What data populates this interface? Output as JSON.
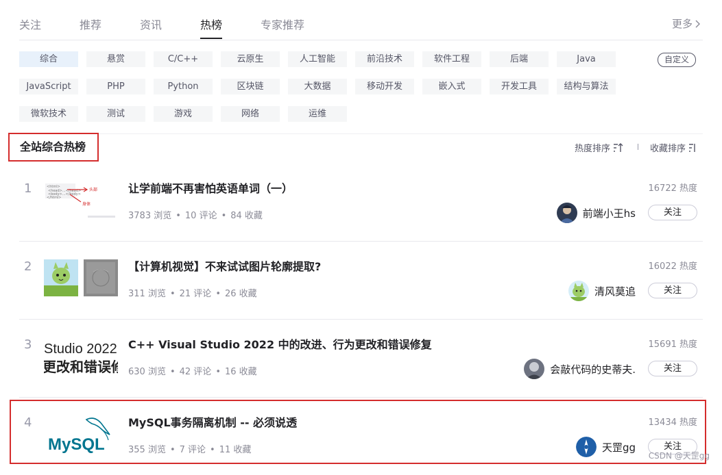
{
  "tabs": [
    {
      "label": "关注"
    },
    {
      "label": "推荐"
    },
    {
      "label": "资讯"
    },
    {
      "label": "热榜",
      "active": true
    },
    {
      "label": "专家推荐"
    }
  ],
  "more_label": "更多",
  "categories": [
    "综合",
    "悬赏",
    "C/C++",
    "云原生",
    "人工智能",
    "前沿技术",
    "软件工程",
    "后端",
    "Java",
    "JavaScript",
    "PHP",
    "Python",
    "区块链",
    "大数据",
    "移动开发",
    "嵌入式",
    "开发工具",
    "结构与算法",
    "微软技术",
    "测试",
    "游戏",
    "网络",
    "运维"
  ],
  "active_category": "综合",
  "custom_label": "自定义",
  "section": {
    "title": "全站综合热榜",
    "sort_heat": "热度排序",
    "sort_fav": "收藏排序"
  },
  "articles": [
    {
      "rank": "1",
      "title": "让学前端不再害怕英语单词（一）",
      "views": "3783 浏览",
      "comments": "10 评论",
      "favorites": "84 收藏",
      "heat": "16722 热度",
      "author": "前端小王hs",
      "follow": "关注"
    },
    {
      "rank": "2",
      "title": "【计算机视觉】不来试试图片轮廓提取?",
      "views": "311 浏览",
      "comments": "21 评论",
      "favorites": "26 收藏",
      "heat": "16022 热度",
      "author": "清风莫追",
      "follow": "关注"
    },
    {
      "rank": "3",
      "title": "C++ Visual Studio 2022 中的改进、行为更改和错误修复",
      "views": "630 浏览",
      "comments": "42 评论",
      "favorites": "16 收藏",
      "heat": "15691 热度",
      "author": "会敲代码的史蒂夫.",
      "follow": "关注",
      "thumb_text": [
        "Studio 2022",
        "更改和错误修"
      ]
    },
    {
      "rank": "4",
      "title": "MySQL事务隔离机制 -- 必须说透",
      "views": "355 浏览",
      "comments": "7 评论",
      "favorites": "11 收藏",
      "heat": "13434 热度",
      "author": "天罡gg",
      "follow": "关注",
      "thumb_text": [
        "MySQL"
      ]
    }
  ],
  "thumb1_text": {
    "l1": "<html>",
    "l2": "<head>...</head>",
    "l3": "<body>...</body>",
    "l4": "</html>",
    "tag_a": "头部",
    "tag_b": "身体"
  },
  "watermark": "CSDN @天罡gg",
  "colors": {
    "accent_red": "#d42c2c",
    "active_cat_bg": "#e8f1fb",
    "mysql_blue": "#00758f",
    "mysql_orange": "#f29111"
  }
}
